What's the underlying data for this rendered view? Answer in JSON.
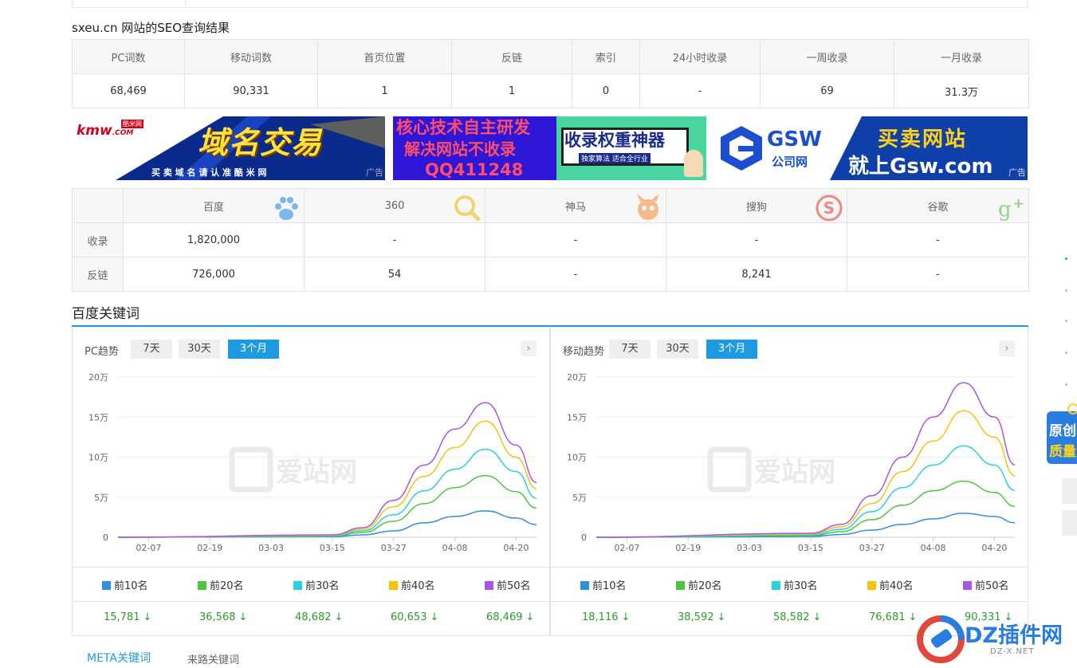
{
  "seo": {
    "title": "sxeu.cn 网站的SEO查询结果",
    "headers": [
      "PC词数",
      "移动词数",
      "首页位置",
      "反链",
      "索引",
      "24小时收录",
      "一周收录",
      "一月收录"
    ],
    "values": [
      "68,469",
      "90,331",
      "1",
      "1",
      "0",
      "-",
      "69",
      "31.3万"
    ]
  },
  "ads": {
    "ad1": {
      "brand": "kmw",
      "brand_sub": ".COM",
      "brand_cn": "酷米网",
      "headline": "域名交易",
      "slogan": "买 卖 域 名 请 认 准 酷 米 网",
      "tag": "广告"
    },
    "ad2": {
      "line1": "核心技术自主研发",
      "line2": "解决网站不收录",
      "line3": "QQ411248",
      "badge": "收录权重神器",
      "badge_sub": "独家算法 适合全行业",
      "tag": "广告"
    },
    "ad3": {
      "brand": "GSW",
      "brand_cn": "公司网",
      "line1": "买卖网站",
      "line2": "就上Gsw.com",
      "tag": "广告"
    }
  },
  "engines": {
    "headers": [
      "",
      "百度",
      "360",
      "神马",
      "搜狗",
      "谷歌"
    ],
    "rows": [
      {
        "label": "收录",
        "values": [
          "1,820,000",
          "-",
          "-",
          "-",
          "-"
        ]
      },
      {
        "label": "反链",
        "values": [
          "726,000",
          "54",
          "-",
          "8,241",
          "-"
        ]
      }
    ],
    "icons": [
      "baidu-icon",
      "360-icon",
      "shenma-icon",
      "sogou-icon",
      "google-plus-icon"
    ]
  },
  "keywords": {
    "section_title": "百度关键词",
    "watermark": "爱站网",
    "panels": [
      {
        "title": "PC趋势",
        "tabs": [
          "7天",
          "30天",
          "3个月"
        ],
        "active_tab": "3个月",
        "next": "›",
        "legend": [
          "前10名",
          "前20名",
          "前30名",
          "前40名",
          "前50名"
        ],
        "totals": [
          "15,781",
          "36,568",
          "48,682",
          "60,653",
          "68,469"
        ],
        "trend": "↓"
      },
      {
        "title": "移动趋势",
        "tabs": [
          "7天",
          "30天",
          "3个月"
        ],
        "active_tab": "3个月",
        "next": "›",
        "legend": [
          "前10名",
          "前20名",
          "前30名",
          "前40名",
          "前50名"
        ],
        "totals": [
          "18,116",
          "38,592",
          "58,582",
          "76,681",
          "90,331"
        ],
        "trend": "↓"
      }
    ]
  },
  "chart_data": [
    {
      "type": "line",
      "title": "PC趋势",
      "x": [
        "02-07",
        "02-19",
        "03-03",
        "03-15",
        "03-27",
        "04-08",
        "04-20"
      ],
      "yticks": [
        "0",
        "5万",
        "10万",
        "15万",
        "20万"
      ],
      "ylim": [
        0,
        200000
      ],
      "series_x": [
        "02-01",
        "03-15",
        "03-21",
        "03-27",
        "04-02",
        "04-08",
        "04-14",
        "04-20",
        "04-24"
      ],
      "series": [
        {
          "name": "前10名",
          "color": "#2f8fe0",
          "values": [
            0,
            800,
            3000,
            8000,
            18000,
            26000,
            33000,
            24000,
            15781
          ]
        },
        {
          "name": "前20名",
          "color": "#4cc63d",
          "values": [
            0,
            1500,
            6000,
            20000,
            42000,
            62000,
            77000,
            57000,
            36568
          ]
        },
        {
          "name": "前30名",
          "color": "#2ad0dc",
          "values": [
            0,
            2000,
            8000,
            28000,
            58000,
            85000,
            110000,
            82000,
            48682
          ]
        },
        {
          "name": "前40名",
          "color": "#f6c20e",
          "values": [
            0,
            2500,
            10000,
            38000,
            76000,
            112000,
            145000,
            100000,
            60653
          ]
        },
        {
          "name": "前50名",
          "color": "#a657e5",
          "values": [
            0,
            3000,
            12000,
            46000,
            90000,
            135000,
            168000,
            115000,
            68469
          ]
        }
      ]
    },
    {
      "type": "line",
      "title": "移动趋势",
      "x": [
        "02-07",
        "02-19",
        "03-03",
        "03-15",
        "03-27",
        "04-08",
        "04-20"
      ],
      "yticks": [
        "0",
        "5万",
        "10万",
        "15万",
        "20万"
      ],
      "ylim": [
        0,
        200000
      ],
      "series_x": [
        "02-01",
        "03-15",
        "03-21",
        "03-27",
        "04-02",
        "04-08",
        "04-14",
        "04-20",
        "04-24"
      ],
      "series": [
        {
          "name": "前10名",
          "color": "#2f8fe0",
          "values": [
            0,
            1000,
            3500,
            9000,
            16000,
            23000,
            30000,
            26000,
            18116
          ]
        },
        {
          "name": "前20名",
          "color": "#4cc63d",
          "values": [
            0,
            2000,
            7000,
            22000,
            40000,
            58000,
            70000,
            56000,
            38592
          ]
        },
        {
          "name": "前30名",
          "color": "#2ad0dc",
          "values": [
            0,
            3000,
            10000,
            32000,
            62000,
            90000,
            114000,
            90000,
            58582
          ]
        },
        {
          "name": "前40名",
          "color": "#f6c20e",
          "values": [
            0,
            4000,
            13000,
            42000,
            82000,
            120000,
            158000,
            125000,
            76681
          ]
        },
        {
          "name": "前50名",
          "color": "#a657e5",
          "values": [
            0,
            5000,
            16000,
            52000,
            100000,
            150000,
            193000,
            150000,
            90331
          ]
        }
      ]
    }
  ],
  "bottom_tabs": [
    "META关键词",
    "来路关键词"
  ],
  "float_badge": {
    "line1": "原创",
    "line2": "质量"
  },
  "corner_logo": {
    "text": "DZ插件网",
    "sub": "DZ-X.NET"
  },
  "colors": {
    "accent": "#1e9be0",
    "down": "#2a9d2a"
  }
}
